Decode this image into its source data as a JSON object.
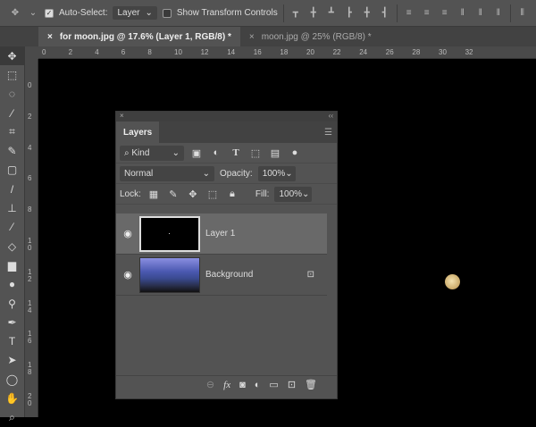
{
  "options_bar": {
    "auto_select_label": "Auto-Select:",
    "auto_select_checked": true,
    "auto_select_target": "Layer",
    "show_transform_label": "Show Transform Controls",
    "show_transform_checked": false
  },
  "tabs": [
    {
      "label": "for moon.jpg @ 17.6% (Layer 1, RGB/8) *",
      "active": true
    },
    {
      "label": "moon.jpg @ 25% (RGB/8) *",
      "active": false
    }
  ],
  "rulers": {
    "horizontal": [
      "0",
      "2",
      "4",
      "6",
      "8",
      "10",
      "12",
      "14",
      "16",
      "18",
      "20",
      "22",
      "24",
      "26",
      "28",
      "30",
      "32"
    ],
    "vertical": [
      "0",
      "2",
      "4",
      "6",
      "8",
      "10",
      "12",
      "14",
      "16",
      "18",
      "20"
    ]
  },
  "tools": [
    "move-tool",
    "marquee-tool",
    "lasso-tool",
    "magic-wand-tool",
    "crop-tool",
    "eyedropper-tool",
    "healing-tool",
    "brush-tool",
    "stamp-tool",
    "history-brush-tool",
    "eraser-tool",
    "gradient-tool",
    "blur-tool",
    "dodge-tool",
    "pen-tool",
    "type-tool",
    "path-selection-tool",
    "ellipse-tool",
    "hand-tool",
    "zoom-tool"
  ],
  "layers_panel": {
    "title": "Layers",
    "filter": "Kind",
    "blend_mode": "Normal",
    "opacity_label": "Opacity:",
    "opacity": "100%",
    "lock_label": "Lock:",
    "fill_label": "Fill:",
    "fill": "100%",
    "layers": [
      {
        "name": "Layer 1",
        "visible": true,
        "selected": true,
        "locked": false
      },
      {
        "name": "Background",
        "visible": true,
        "selected": false,
        "locked": true
      }
    ]
  },
  "colors": {
    "panel": "#535353",
    "canvas": "#000000",
    "selected_layer": "#696969"
  }
}
